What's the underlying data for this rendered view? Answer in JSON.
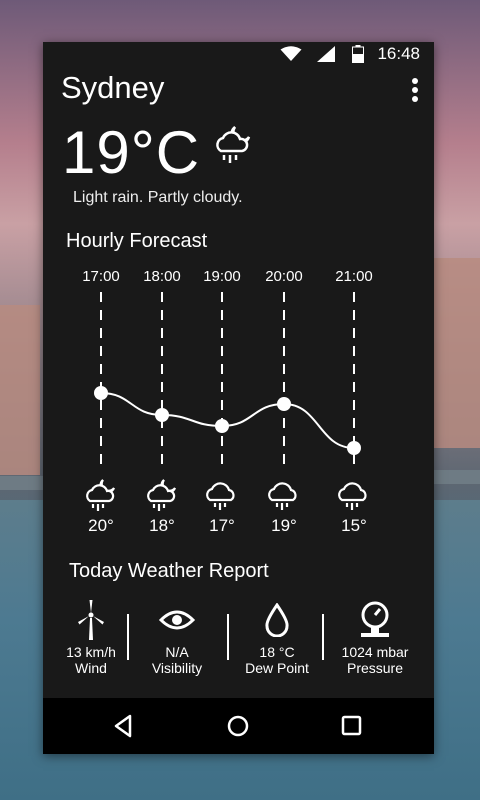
{
  "status_bar": {
    "time": "16:48"
  },
  "location": {
    "city": "Sydney"
  },
  "current": {
    "temperature": "19°C",
    "description": "Light rain. Partly cloudy.",
    "icon": "partly-cloudy-rain-icon"
  },
  "hourly": {
    "title": "Hourly Forecast",
    "hours": [
      {
        "time": "17:00",
        "temp": "20°",
        "temp_value": 20,
        "icon": "partly-cloudy-rain-icon"
      },
      {
        "time": "18:00",
        "temp": "18°",
        "temp_value": 18,
        "icon": "partly-cloudy-rain-icon"
      },
      {
        "time": "19:00",
        "temp": "17°",
        "temp_value": 17,
        "icon": "rain-icon"
      },
      {
        "time": "20:00",
        "temp": "19°",
        "temp_value": 19,
        "icon": "rain-icon"
      },
      {
        "time": "21:00",
        "temp": "15°",
        "temp_value": 15,
        "icon": "rain-icon"
      }
    ]
  },
  "report": {
    "title": "Today Weather Report",
    "items": [
      {
        "value": "13 km/h",
        "label": "Wind",
        "icon": "wind-turbine-icon"
      },
      {
        "value": "N/A",
        "label": "Visibility",
        "icon": "eye-icon"
      },
      {
        "value": "18 °C",
        "label": "Dew Point",
        "icon": "water-drop-icon"
      },
      {
        "value": "1024 mbar",
        "label": "Pressure",
        "icon": "barometer-icon"
      }
    ]
  },
  "nav": {
    "buttons": [
      "back-icon",
      "home-icon",
      "recents-icon"
    ]
  },
  "colors": {
    "card": "#191919",
    "navbar": "#000000",
    "text": "#ffffff"
  }
}
